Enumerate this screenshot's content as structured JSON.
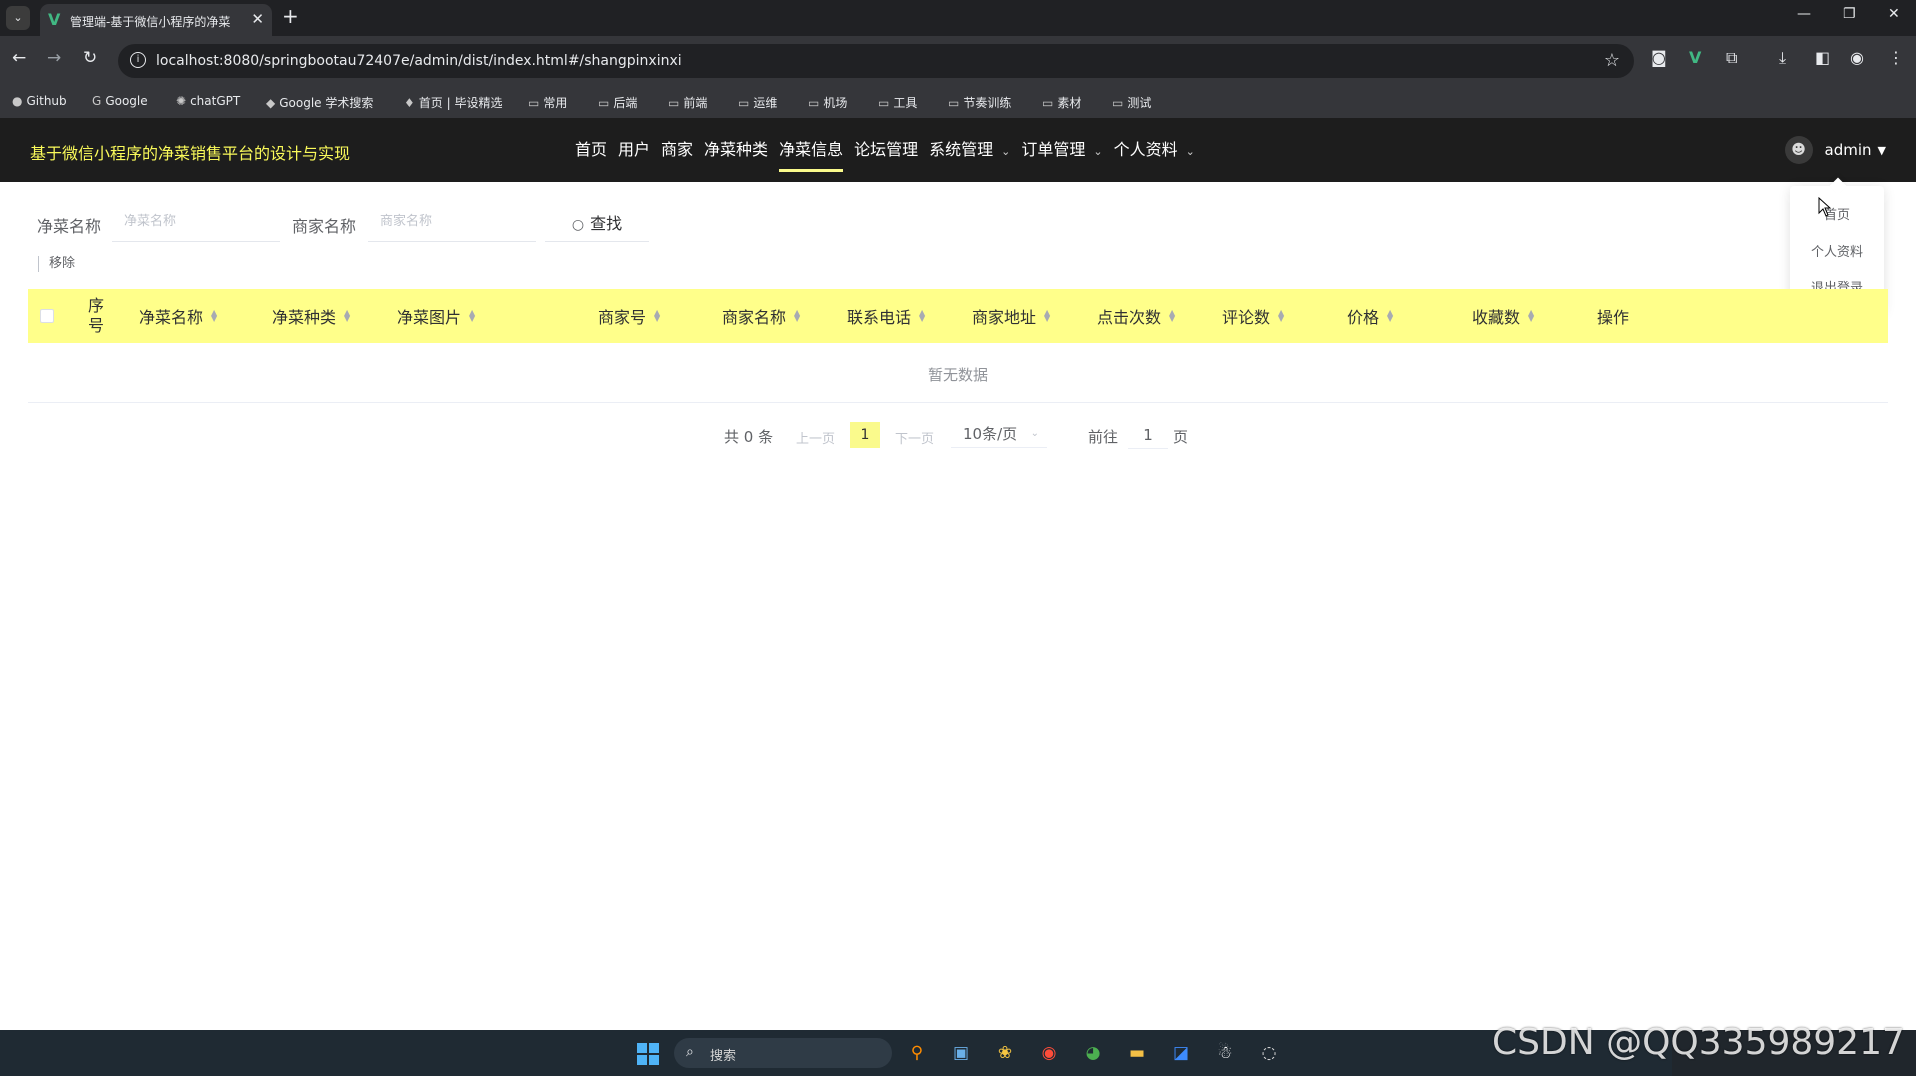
{
  "browser": {
    "tab_title": "管理端-基于微信小程序的净菜",
    "url": "localhost:8080/springbootau72407e/admin/dist/index.html#/shangpinxinxi",
    "bookmarks": [
      "Github",
      "Google",
      "chatGPT",
      "Google 学术搜索",
      "首页 | 毕设精选",
      "常用",
      "后端",
      "前端",
      "运维",
      "机场",
      "工具",
      "节奏训练",
      "素材",
      "测试"
    ]
  },
  "header": {
    "app_title": "基于微信小程序的净菜销售平台的设计与实现",
    "menu": [
      {
        "label": "首页"
      },
      {
        "label": "用户"
      },
      {
        "label": "商家"
      },
      {
        "label": "净菜种类"
      },
      {
        "label": "净菜信息"
      },
      {
        "label": "论坛管理"
      },
      {
        "label": "系统管理"
      },
      {
        "label": "订单管理"
      },
      {
        "label": "个人资料"
      }
    ],
    "active_menu": "净菜信息",
    "user_name": "admin"
  },
  "user_dropdown": {
    "items": [
      "首页",
      "个人资料",
      "退出登录"
    ]
  },
  "search": {
    "name_label": "净菜名称",
    "name_placeholder": "净菜名称",
    "merchant_label": "商家名称",
    "merchant_placeholder": "商家名称",
    "button_label": "查找"
  },
  "actions": {
    "remove_label": "移除"
  },
  "table": {
    "columns": [
      "序号",
      "净菜名称",
      "净菜种类",
      "净菜图片",
      "商家号",
      "商家名称",
      "联系电话",
      "商家地址",
      "点击次数",
      "评论数",
      "价格",
      "收藏数",
      "操作"
    ],
    "seq_header_line1": "序",
    "seq_header_line2": "号",
    "empty_text": "暂无数据"
  },
  "pagination": {
    "total_text": "共 0 条",
    "prev_label": "上一页",
    "next_label": "下一页",
    "current_page": "1",
    "page_size": "10条/页",
    "goto_label": "前往",
    "goto_value": "1",
    "page_unit": "页"
  },
  "taskbar": {
    "search_placeholder": "搜索"
  },
  "watermark": "CSDN @QQ335989217"
}
